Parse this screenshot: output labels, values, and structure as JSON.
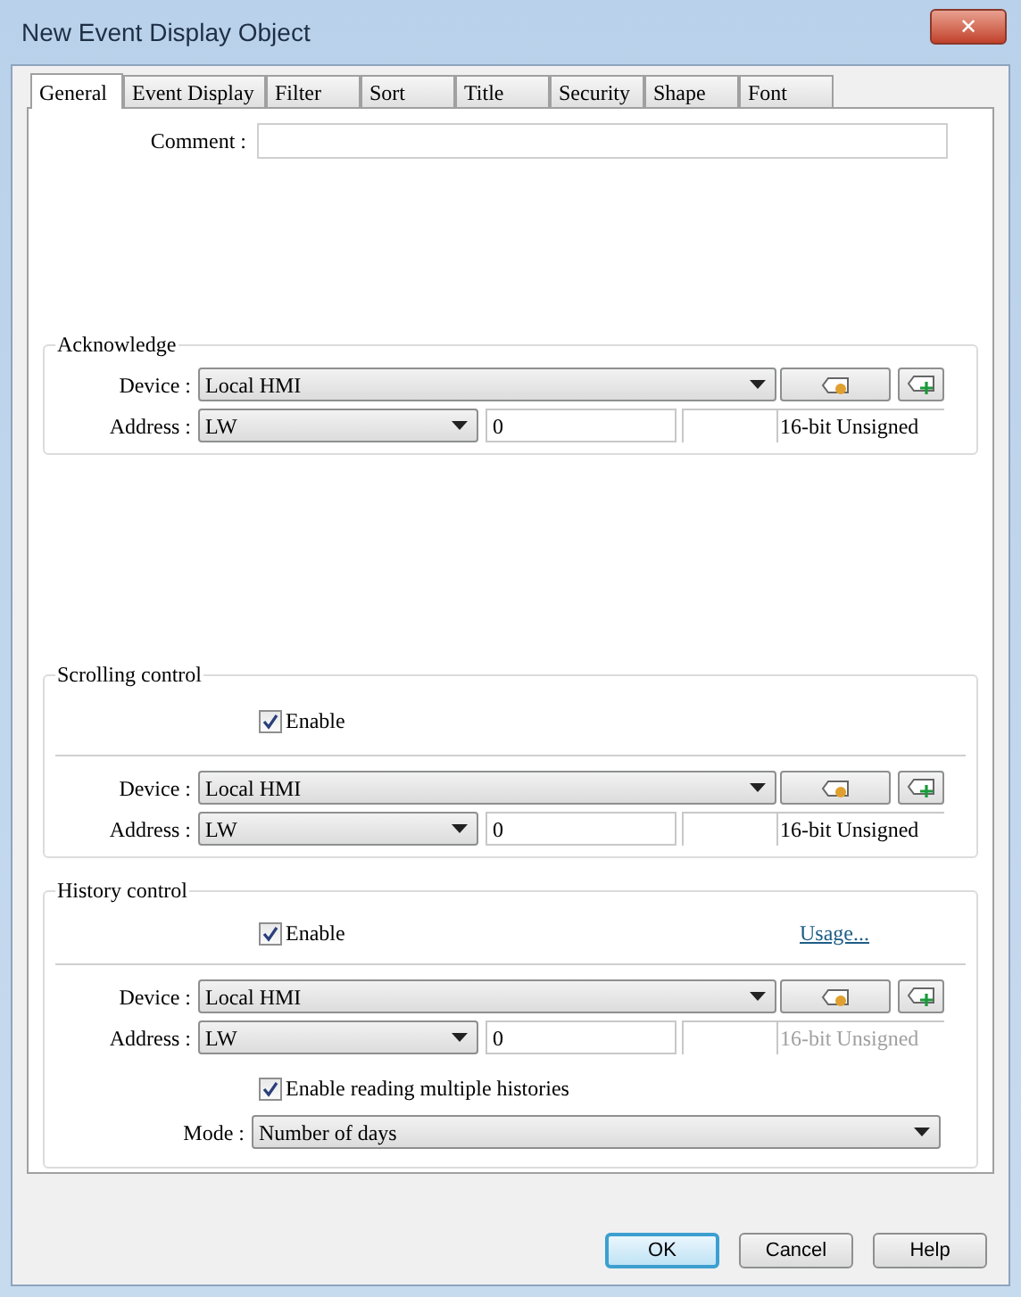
{
  "window": {
    "title": "New Event Display Object",
    "close": "✕"
  },
  "tabs": [
    {
      "label": "General",
      "selected": true
    },
    {
      "label": "Event Display",
      "selected": false
    },
    {
      "label": "Filter",
      "selected": false
    },
    {
      "label": "Sort",
      "selected": false
    },
    {
      "label": "Title",
      "selected": false
    },
    {
      "label": "Security",
      "selected": false
    },
    {
      "label": "Shape",
      "selected": false
    },
    {
      "label": "Font",
      "selected": false
    }
  ],
  "comment": {
    "label": "Comment :"
  },
  "acknowledge": {
    "title": "Acknowledge",
    "device_label": "Device :",
    "device": "Local HMI",
    "address_label": "Address :",
    "address_type": "LW",
    "address": "0",
    "data_type": "16-bit Unsigned",
    "data_type_disabled": false
  },
  "scrolling_control": {
    "title": "Scrolling control",
    "enable": {
      "label": "Enable",
      "checked": true
    },
    "device_label": "Device :",
    "device": "Local HMI",
    "address_label": "Address :",
    "address_type": "LW",
    "address": "0",
    "data_type": "16-bit Unsigned",
    "data_type_disabled": false
  },
  "history_control": {
    "title": "History control",
    "enable": {
      "label": "Enable",
      "checked": true
    },
    "usage_link": "Usage...",
    "device_label": "Device :",
    "device": "Local HMI",
    "address_label": "Address :",
    "address_type": "LW",
    "address": "0",
    "data_type": "16-bit Unsigned",
    "data_type_disabled": true,
    "multiple": {
      "label": "Enable reading multiple histories",
      "checked": true
    },
    "mode_label": "Mode :",
    "mode": "Number of days"
  },
  "buttons": [
    {
      "label": "OK",
      "default": true
    },
    {
      "label": "Cancel",
      "default": false
    },
    {
      "label": "Help",
      "default": false
    }
  ]
}
